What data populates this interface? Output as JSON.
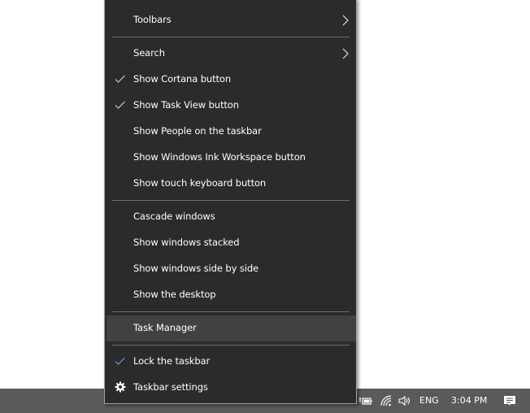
{
  "context_menu": {
    "items": [
      {
        "label": "Toolbars",
        "checked": false,
        "submenu": true
      },
      {
        "label": "Search",
        "checked": false,
        "submenu": true
      },
      {
        "label": "Show Cortana button",
        "checked": true,
        "submenu": false
      },
      {
        "label": "Show Task View button",
        "checked": true,
        "submenu": false
      },
      {
        "label": "Show People on the taskbar",
        "checked": false,
        "submenu": false
      },
      {
        "label": "Show Windows Ink Workspace button",
        "checked": false,
        "submenu": false
      },
      {
        "label": "Show touch keyboard button",
        "checked": false,
        "submenu": false
      },
      {
        "label": "Cascade windows",
        "checked": false,
        "submenu": false
      },
      {
        "label": "Show windows stacked",
        "checked": false,
        "submenu": false
      },
      {
        "label": "Show windows side by side",
        "checked": false,
        "submenu": false
      },
      {
        "label": "Show the desktop",
        "checked": false,
        "submenu": false
      },
      {
        "label": "Task Manager",
        "checked": false,
        "submenu": false,
        "highlighted": true
      },
      {
        "label": "Lock the taskbar",
        "checked": true,
        "submenu": false
      },
      {
        "label": "Taskbar settings",
        "checked": false,
        "submenu": false,
        "icon": "gear-icon"
      }
    ]
  },
  "taskbar": {
    "tray": {
      "battery_icon": "battery-charging-icon",
      "network_icon": "wifi-icon",
      "volume_icon": "speaker-icon",
      "language": "ENG",
      "time": "3:04 PM",
      "notifications_icon": "action-center-icon"
    }
  },
  "colors": {
    "menu_bg": "#2b2b2b",
    "menu_hover": "#414141",
    "taskbar_bg": "#5a5a5a",
    "check_color": "#5aa0e0"
  }
}
